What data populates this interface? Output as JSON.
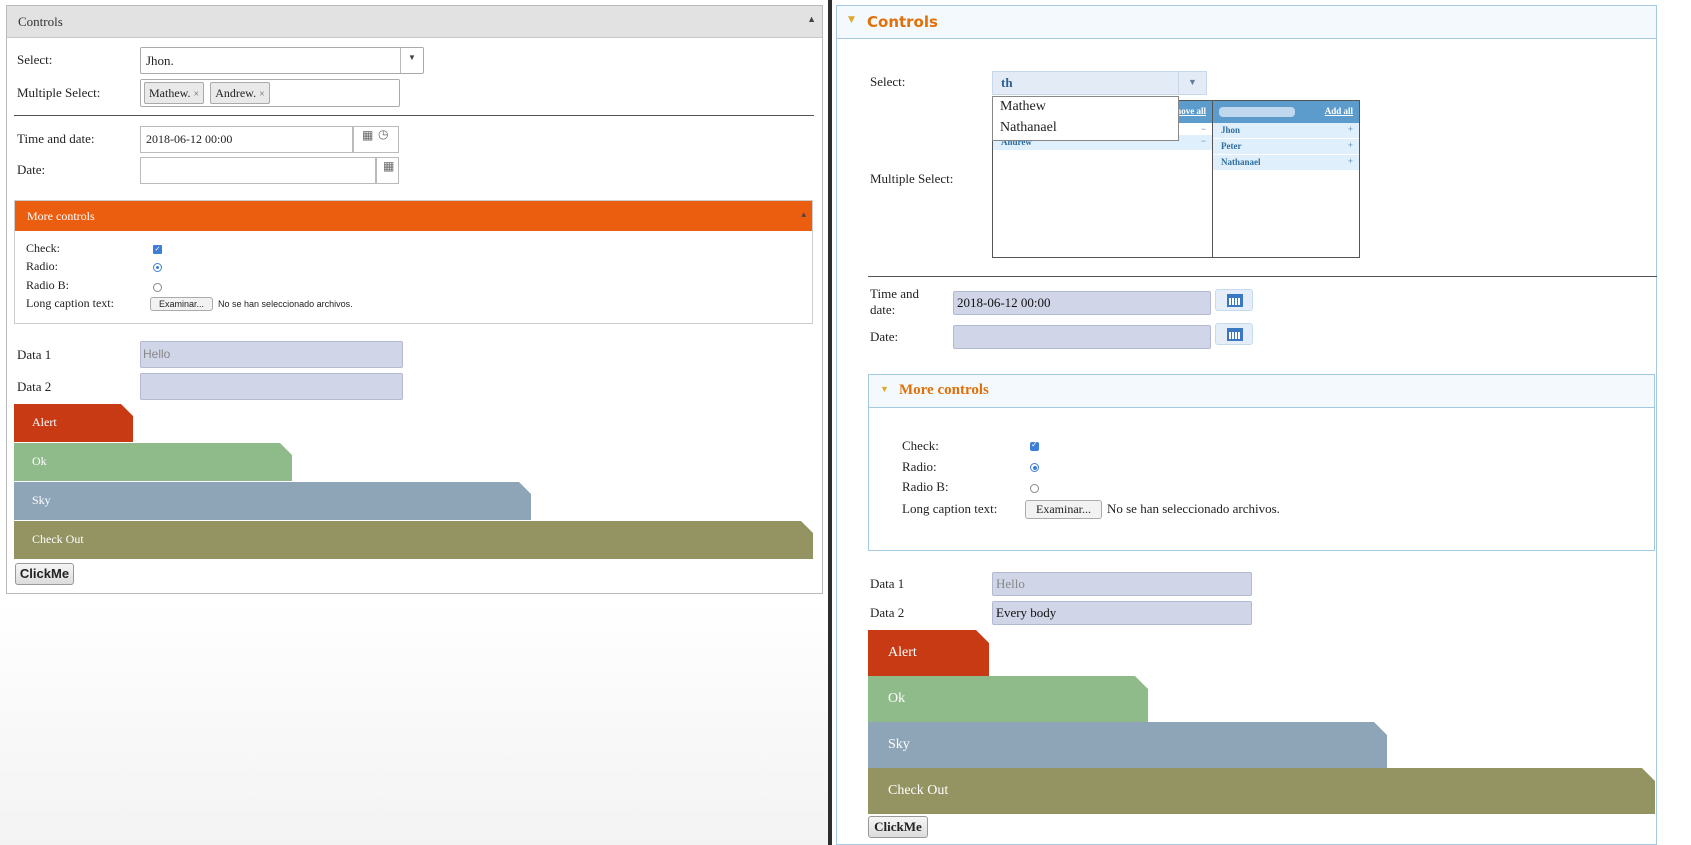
{
  "left": {
    "panel_title": "Controls",
    "collapse_glyph": "▲",
    "select": {
      "label": "Select:",
      "value": "Jhon.",
      "arrow": "▼"
    },
    "multiple_select": {
      "label": "Multiple Select:",
      "chips": [
        "Mathew.",
        "Andrew."
      ],
      "remove_glyph": "×"
    },
    "time_and_date": {
      "label": "Time and date:",
      "value": "2018-06-12 00:00"
    },
    "date": {
      "label": "Date:",
      "value": ""
    },
    "more_controls": {
      "title": "More controls",
      "check_label": "Check:",
      "radio_label": "Radio:",
      "radio_b_label": "Radio B:",
      "long_caption_label": "Long caption text:",
      "file_button": "Examinar...",
      "file_status": "No se han seleccionado archivos."
    },
    "data1": {
      "label": "Data 1",
      "value": "Hello"
    },
    "data2": {
      "label": "Data 2",
      "value": ""
    },
    "buttons": [
      {
        "label": "Alert",
        "color": "#c73a14"
      },
      {
        "label": "Ok",
        "color": "#8fba8a"
      },
      {
        "label": "Sky",
        "color": "#8ea5b8"
      },
      {
        "label": "Check Out",
        "color": "#949362"
      }
    ],
    "clickme": "ClickMe"
  },
  "right": {
    "panel_title": "Controls",
    "select": {
      "label": "Select:",
      "value": "th",
      "arrow": "▼"
    },
    "select_dropdown": [
      "Mathew",
      "Nathanael"
    ],
    "multiple_select": {
      "label": "Multiple Select:",
      "remove_all": "Remove all",
      "add_all": "Add all",
      "selected": [
        "Andrew"
      ],
      "available": [
        "Jhon",
        "Peter",
        "Nathanael"
      ],
      "remove_glyph": "−",
      "add_glyph": "+"
    },
    "time_and_date": {
      "label_line1": "Time and",
      "label_line2": "date:",
      "value": "2018-06-12 00:00"
    },
    "date": {
      "label": "Date:",
      "value": ""
    },
    "more_controls": {
      "title": "More controls",
      "check_label": "Check:",
      "radio_label": "Radio:",
      "radio_b_label": "Radio B:",
      "long_caption_label": "Long caption text:",
      "file_button": "Examinar...",
      "file_status": "No se han seleccionado archivos."
    },
    "data1": {
      "label": "Data 1",
      "value": "Hello"
    },
    "data2": {
      "label": "Data 2",
      "value": "Every body"
    },
    "buttons": [
      {
        "label": "Alert",
        "color": "#c73a14"
      },
      {
        "label": "Ok",
        "color": "#8fba8a"
      },
      {
        "label": "Sky",
        "color": "#8ea5b8"
      },
      {
        "label": "Check Out",
        "color": "#949362"
      }
    ],
    "clickme": "ClickMe"
  }
}
